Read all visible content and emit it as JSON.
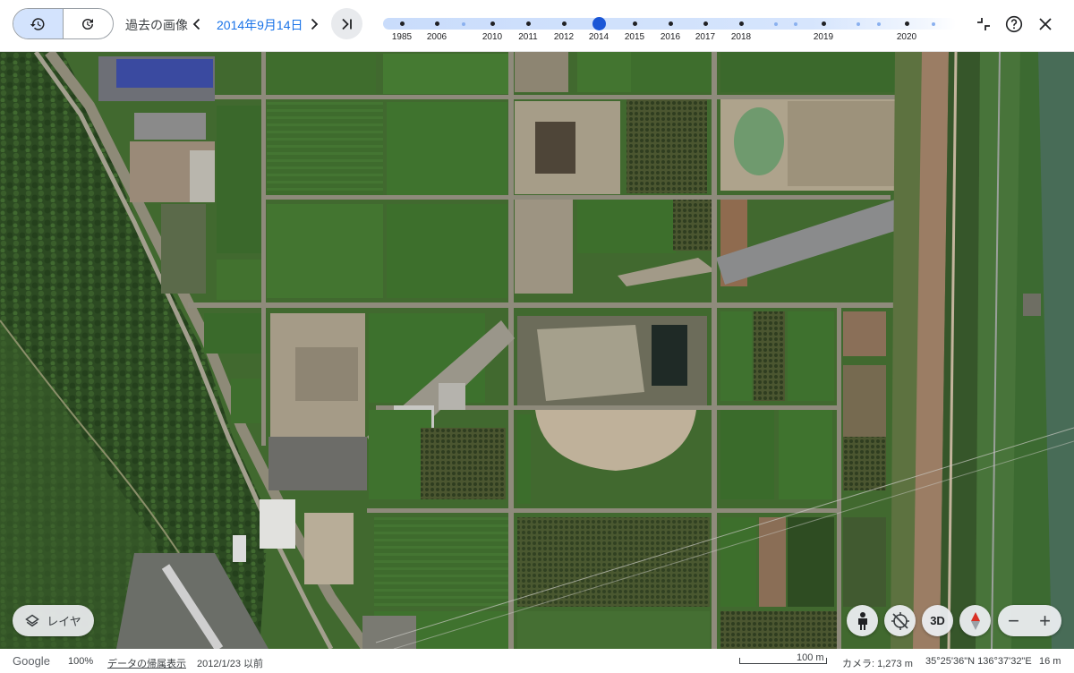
{
  "toolbar": {
    "history_label": "過去の画像",
    "date_label": "2014年9月14日",
    "prev_icon": "chevron-left-icon",
    "next_icon": "chevron-right-icon",
    "latest_icon": "skip-to-latest-icon"
  },
  "timeline": {
    "years": [
      "1985",
      "2006",
      "2010",
      "2011",
      "2012",
      "2014",
      "2015",
      "2016",
      "2017",
      "2018",
      "2019",
      "2020"
    ],
    "selected_year": "2014",
    "selected_color": "#1a56d6"
  },
  "map_controls": {
    "layers_label": "レイヤ",
    "btn_3d_label": "3D",
    "zoom_out_label": "−",
    "zoom_in_label": "+"
  },
  "status": {
    "brand": "Google",
    "zoom_level": "100%",
    "data_attribution": "データの帰属表示",
    "imagery_date": "2012/1/23 以前",
    "scale": "100 m",
    "camera": "カメラ: 1,273 m",
    "coordinates": "35°25'36\"N 136°37'32\"E",
    "elevation": "16 m"
  },
  "colors": {
    "accent_blue": "#1a73e8",
    "active_toggle": "#d3e3fd"
  }
}
